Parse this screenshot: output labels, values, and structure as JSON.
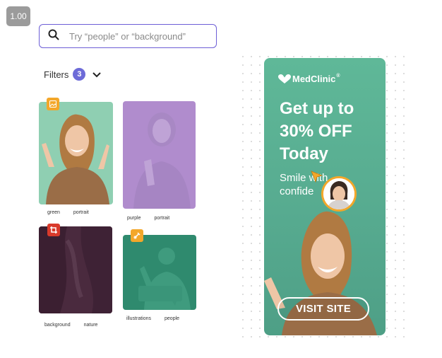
{
  "zoom": "1.00",
  "search": {
    "placeholder": "Try “people” or “background”",
    "value": ""
  },
  "filters": {
    "label": "Filters",
    "count": "3"
  },
  "thumbnails": [
    {
      "tag_icon": "image-icon",
      "tag_color": "#f3a72a",
      "tags": [
        "green",
        "portrait"
      ],
      "bg": "#8fcfb2"
    },
    {
      "tags": [
        "purple",
        "portrait"
      ],
      "bg": "#b08ccd"
    },
    {
      "tag_icon": "crop-icon",
      "tag_color": "#d93a2b",
      "tags": [
        "background",
        "nature"
      ],
      "bg": "#4a2a3e"
    },
    {
      "tag_icon": "brush-icon",
      "tag_color": "#f3a72a",
      "tags": [
        "illustrations",
        "people"
      ],
      "bg": "#2f8a6e"
    }
  ],
  "ad": {
    "brand": "MedClinic",
    "brand_mark": "®",
    "headline_1": "Get up to",
    "headline_2": "30% OFF",
    "headline_3": "Today",
    "subline_1": "Smile with",
    "subline_2": "confide",
    "cta": "VISIT SITE"
  },
  "colors": {
    "accent": "#6d5fd6",
    "ad_green": "#5fb898",
    "orange": "#f3a72a"
  }
}
